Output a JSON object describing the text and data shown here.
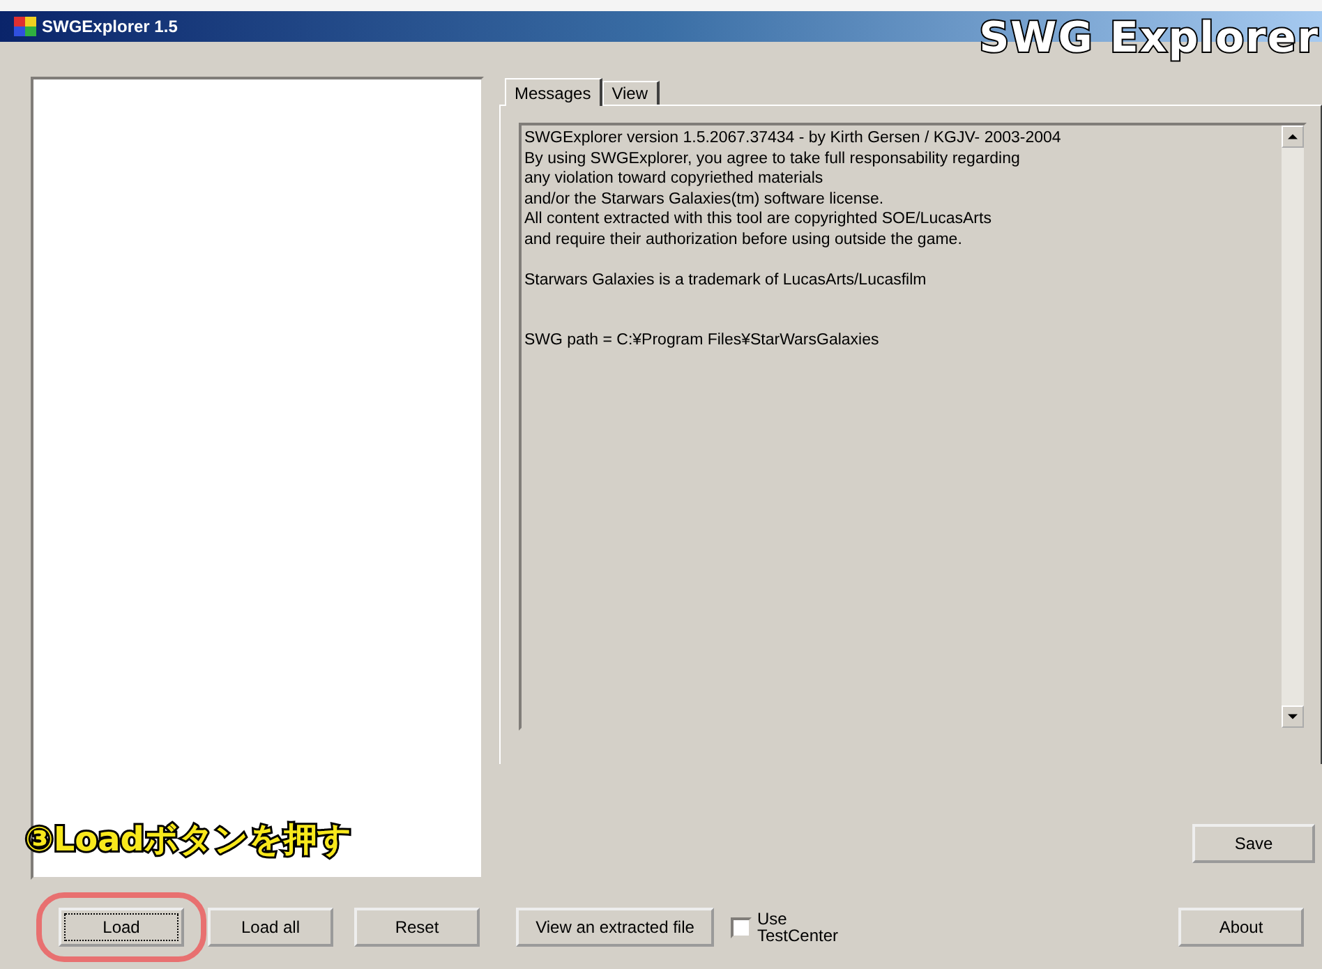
{
  "window": {
    "title": "SWGExplorer 1.5"
  },
  "overlay_title": "SWG Explorer",
  "tabs": [
    {
      "label": "Messages",
      "selected": true
    },
    {
      "label": "View",
      "selected": false
    }
  ],
  "messages": "SWGExplorer version 1.5.2067.37434 - by Kirth Gersen / KGJV- 2003-2004\nBy using SWGExplorer, you agree to take full responsability regarding\nany violation toward copyriethed materials\nand/or the Starwars Galaxies(tm) software license.\nAll content extracted with this tool are copyrighted SOE/LucasArts\nand require their authorization before using outside the game.\n\nStarwars Galaxies is a trademark of LucasArts/Lucasfilm\n\n\nSWG path = C:¥Program Files¥StarWarsGalaxies",
  "save_button": "Save",
  "annotation": "③Loadボタンを押す",
  "bottom_buttons": [
    {
      "label": "Load",
      "highlighted": true
    },
    {
      "label": "Load all",
      "highlighted": false
    },
    {
      "label": "Reset",
      "highlighted": false
    },
    {
      "label": "View an extracted file",
      "highlighted": false
    }
  ],
  "checkbox": {
    "label": "Use TestCenter",
    "checked": false
  },
  "about_button": "About"
}
